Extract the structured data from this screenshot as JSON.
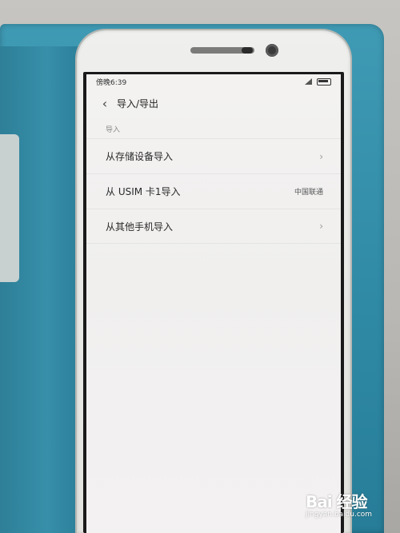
{
  "status_bar": {
    "time": "傍晚6:39"
  },
  "header": {
    "back_glyph": "‹",
    "title": "导入/导出"
  },
  "section": {
    "label": "导入"
  },
  "rows": [
    {
      "label": "从存储设备导入",
      "value": "",
      "chevron": "›"
    },
    {
      "label": "从 USIM 卡1导入",
      "value": "中国联通",
      "chevron": ""
    },
    {
      "label": "从其他手机导入",
      "value": "",
      "chevron": "›"
    }
  ],
  "watermark": {
    "logo": "Bai 经验",
    "site": "jingyan.baidu.com"
  },
  "colors": {
    "case": "#2f8aa6",
    "screen": "#f2f1f0"
  }
}
